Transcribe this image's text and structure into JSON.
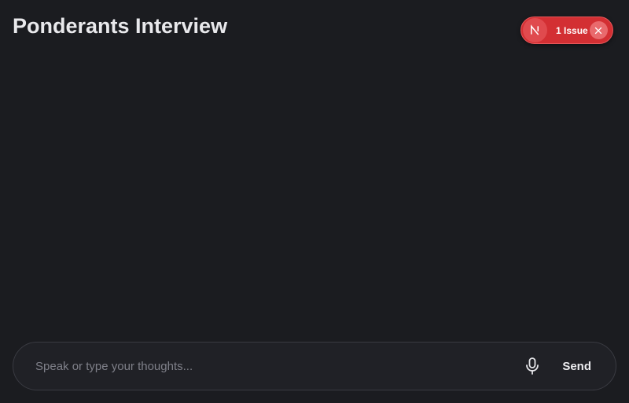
{
  "header": {
    "title": "Ponderants Interview"
  },
  "dev_overlay": {
    "logo_letter": "N",
    "issue_label": "1 Issue",
    "accent_color": "#d32f33"
  },
  "composer": {
    "placeholder": "Speak or type your thoughts...",
    "value": "",
    "mic_icon": "microphone-icon",
    "send_label": "Send"
  }
}
